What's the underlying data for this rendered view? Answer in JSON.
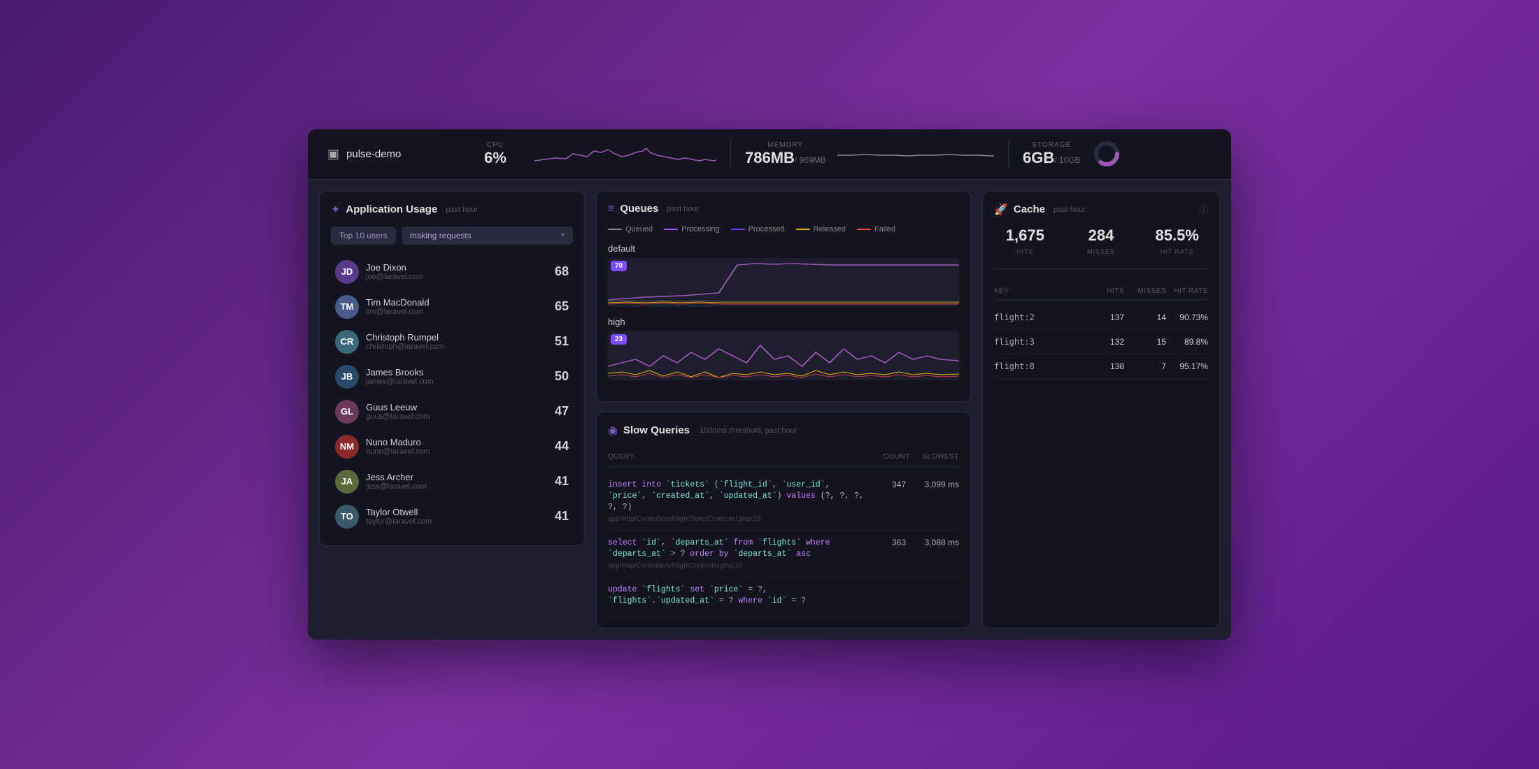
{
  "header": {
    "brand": "pulse-demo",
    "cpu": {
      "label": "CPU",
      "value": "6%"
    },
    "memory": {
      "label": "MEMORY",
      "value": "786MB",
      "unit": "/ 969MB"
    },
    "storage": {
      "label": "STORAGE",
      "value": "6GB",
      "unit": "/ 10GB",
      "percent": 60
    }
  },
  "application_usage": {
    "title": "Application Usage",
    "subtitle": "past hour",
    "filter_badge": "Top 10 users",
    "filter_select": "making requests",
    "users": [
      {
        "name": "Joe Dixon",
        "email": "joe@laravel.com",
        "count": 68,
        "initials": "JD",
        "color": "av-1"
      },
      {
        "name": "Tim MacDonald",
        "email": "tim@laravel.com",
        "count": 65,
        "initials": "TM",
        "color": "av-2"
      },
      {
        "name": "Christoph Rumpel",
        "email": "christoph@laravel.com",
        "count": 51,
        "initials": "CR",
        "color": "av-3"
      },
      {
        "name": "James Brooks",
        "email": "james@laravel.com",
        "count": 50,
        "initials": "JB",
        "color": "av-4"
      },
      {
        "name": "Guus Leeuw",
        "email": "guus@laravel.com",
        "count": 47,
        "initials": "GL",
        "color": "av-5"
      },
      {
        "name": "Nuno Maduro",
        "email": "nuno@laravel.com",
        "count": 44,
        "initials": "NM",
        "color": "av-6"
      },
      {
        "name": "Jess Archer",
        "email": "jess@laravel.com",
        "count": 41,
        "initials": "JA",
        "color": "av-7"
      },
      {
        "name": "Taylor Otwell",
        "email": "taylor@laravel.com",
        "count": 41,
        "initials": "TO",
        "color": "av-8"
      }
    ]
  },
  "queues": {
    "title": "Queues",
    "subtitle": "past hour",
    "legend": [
      {
        "label": "Queued",
        "color": "#888"
      },
      {
        "label": "Processing",
        "color": "#a855f7"
      },
      {
        "label": "Processed",
        "color": "#7c3aed"
      },
      {
        "label": "Released",
        "color": "#eab308"
      },
      {
        "label": "Failed",
        "color": "#ef4444"
      }
    ],
    "sections": [
      {
        "label": "default",
        "badge": 70
      },
      {
        "label": "high",
        "badge": 23
      }
    ]
  },
  "cache": {
    "title": "Cache",
    "subtitle": "past hour",
    "stats": [
      {
        "value": "1,675",
        "label": "HITS"
      },
      {
        "value": "284",
        "label": "MISSES"
      },
      {
        "value": "85.5%",
        "label": "HIT RATE"
      }
    ],
    "columns": [
      "KEY",
      "HITS",
      "MISSES",
      "HIT RATE"
    ],
    "rows": [
      {
        "key": "flight:2",
        "hits": 137,
        "misses": 14,
        "rate": "90.73%"
      },
      {
        "key": "flight:3",
        "hits": 132,
        "misses": 15,
        "rate": "89.8%"
      },
      {
        "key": "flight:8",
        "hits": 138,
        "misses": 7,
        "rate": "95.17%"
      }
    ]
  },
  "slow_queries": {
    "title": "Slow Queries",
    "threshold": "1000ms threshold, past hour",
    "columns": [
      "QUERY",
      "COUNT",
      "SLOWEST"
    ],
    "rows": [
      {
        "query": "insert into `tickets` (`flight_id`, `user_id`, `price`, `created_at`, `updated_at`) values (?, ?, ?, ?, ?)",
        "file": "app/Http/Controllers/FlightTicketController.php:26",
        "count": 347,
        "slowest": "3,099 ms"
      },
      {
        "query": "select `id`, `departs_at` from `flights` where `departs_at` > ? order by `departs_at` asc",
        "file": "app/Http/Controllers/FlightController.php:31",
        "count": 363,
        "slowest": "3,088 ms"
      },
      {
        "query": "update `flights` set `price` = ?, `flights`.`updated_at` = ? where `id` = ?",
        "file": "",
        "count": null,
        "slowest": null
      }
    ]
  }
}
